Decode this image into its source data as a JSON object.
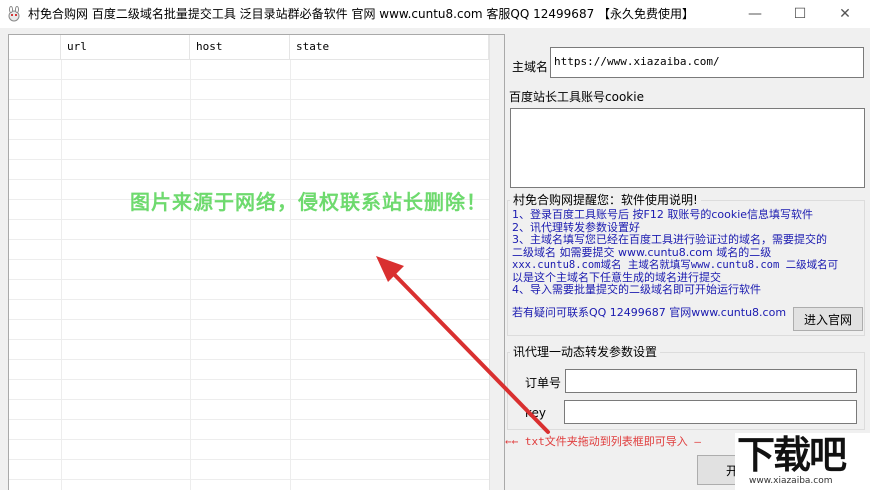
{
  "window": {
    "title": "村免合购网 百度二级域名批量提交工具 泛目录站群必备软件 官网 www.cuntu8.com 客服QQ 12499687 【永久免费使用】",
    "minimize_glyph": "—",
    "maximize_glyph": "☐",
    "close_glyph": "✕"
  },
  "list": {
    "columns": [
      "",
      "url",
      "host",
      "state"
    ]
  },
  "form": {
    "main_domain_label": "主域名",
    "main_domain_value": "https://www.xiazaiba.com/",
    "cookie_label": "百度站长工具账号cookie",
    "cookie_value": ""
  },
  "notice": {
    "group_title": "村免合购网提醒您：软件使用说明!",
    "lines": [
      "1、登录百度工具账号后 按F12 取账号的cookie信息填写软件",
      "2、讯代理转发参数设置好",
      "3、主域名填写您已经在百度工具进行验证过的域名，需要提交的",
      "二级域名 如需要提交 www.cuntu8.com 域名的二级",
      "xxx.cuntu8.com域名 主域名就填写www.cuntu8.com 二级域名可",
      "以是这个主域名下任意生成的域名进行提交",
      "4、导入需要批量提交的二级域名即可开始运行软件"
    ],
    "contact": "若有疑问可联系QQ 12499687 官网www.cuntu8.com",
    "visit_button": "进入官网"
  },
  "proxy": {
    "group_title": "讯代理一动态转发参数设置",
    "order_label": "订单号",
    "order_value": "",
    "key_label": "key",
    "key_value": ""
  },
  "hint": "←← txt文件夹拖动到列表框即可导入 —",
  "start_button_partial": "开",
  "watermark": "图片来源于网络，侵权联系站长删除！",
  "logo": {
    "text": "下载吧",
    "url": "www.xiazaiba.com"
  },
  "colors": {
    "notice_text": "#1a1ab0",
    "hint_text": "#e03c3c",
    "watermark": "#5fd65f",
    "arrow": "#d93030"
  }
}
